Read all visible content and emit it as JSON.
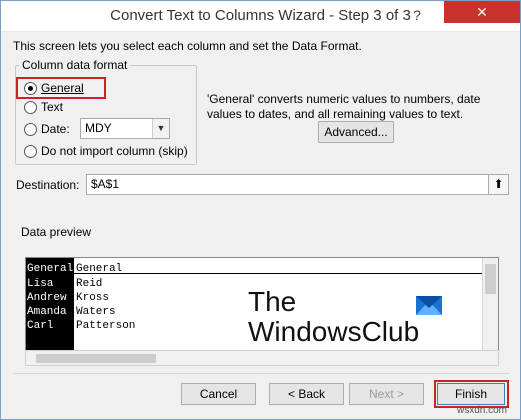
{
  "window": {
    "title": "Convert Text to Columns Wizard - Step 3 of 3",
    "help_label": "?",
    "close_label": "✕"
  },
  "intro": "This screen lets you select each column and set the Data Format.",
  "column_format": {
    "legend": "Column data format",
    "options": [
      {
        "label": "General",
        "checked": true
      },
      {
        "label": "Text",
        "checked": false
      },
      {
        "label": "Date:",
        "checked": false
      },
      {
        "label": "Do not import column (skip)",
        "checked": false
      }
    ],
    "date_format": "MDY"
  },
  "description": "'General' converts numeric values to numbers, date values to dates, and all remaining values to text.",
  "advanced_label": "Advanced...",
  "destination": {
    "label": "Destination:",
    "value": "$A$1",
    "collapse_icon": "⬆"
  },
  "preview": {
    "legend": "Data preview",
    "headers": [
      "General",
      "General"
    ],
    "rows": [
      [
        "Lisa",
        "Reid"
      ],
      [
        "Andrew",
        "Kross"
      ],
      [
        "Amanda",
        "Waters"
      ],
      [
        "Carl",
        "Patterson"
      ]
    ]
  },
  "watermark": {
    "line1": "The",
    "line2": "WindowsClub"
  },
  "buttons": {
    "cancel": "Cancel",
    "back": "< Back",
    "next": "Next >",
    "finish": "Finish"
  },
  "footer_watermark": "wsxdn.com",
  "colors": {
    "highlight": "#cc2222",
    "close": "#c7322b",
    "logo": "#1a73d1"
  }
}
